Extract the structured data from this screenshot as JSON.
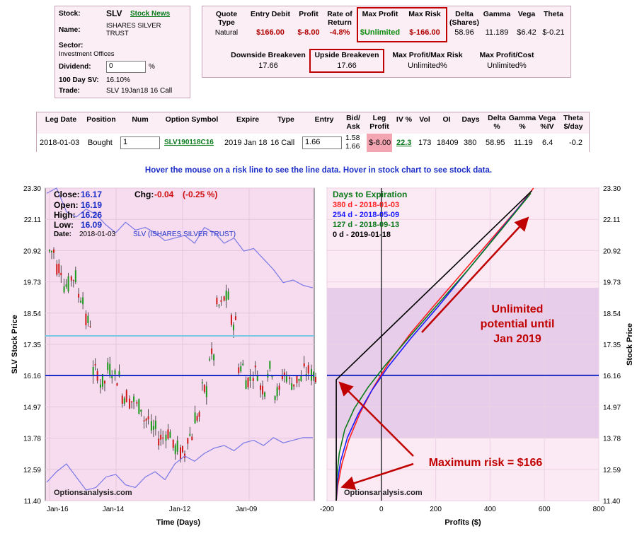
{
  "stock_info": {
    "stock_label": "Stock:",
    "ticker": "SLV",
    "news_link": "Stock News",
    "name_label": "Name:",
    "name_line1": "ISHARES SILVER",
    "name_line2": "TRUST",
    "sector_label": "Sector:",
    "sector": "Investment Offices",
    "dividend_label": "Dividend:",
    "dividend_value": "0",
    "dividend_unit": "%",
    "sv_label": "100 Day SV:",
    "sv_value": "16.10%",
    "trade_label": "Trade:",
    "trade_value": "SLV 19Jan18 16 Call"
  },
  "quote": {
    "headers": {
      "quote_type": "Quote Type",
      "entry_debit": "Entry Debit",
      "profit": "Profit",
      "ror": "Rate of Return",
      "max_profit": "Max Profit",
      "max_risk": "Max Risk",
      "delta": "Delta (Shares)",
      "gamma": "Gamma",
      "vega": "Vega",
      "theta": "Theta"
    },
    "values": {
      "quote_type": "Natural",
      "entry_debit": "$166.00",
      "profit": "$-8.00",
      "ror": "-4.8%",
      "max_profit": "$Unlimited",
      "max_risk": "$-166.00",
      "delta": "58.96",
      "gamma": "11.189",
      "vega": "$6.42",
      "theta": "$-0.21"
    },
    "row2_headers": {
      "downside": "Downside Breakeven",
      "upside": "Upside Breakeven",
      "mp_mr": "Max Profit/Max Risk",
      "mp_cost": "Max Profit/Cost"
    },
    "row2_values": {
      "downside": "17.66",
      "upside": "17.66",
      "mp_mr": "Unlimited%",
      "mp_cost": "Unlimited%"
    }
  },
  "legs": {
    "headers": {
      "leg_date": "Leg Date",
      "position": "Position",
      "num": "Num",
      "symbol": "Option Symbol",
      "expire": "Expire",
      "type": "Type",
      "entry": "Entry",
      "bid_ask": "Bid/ Ask",
      "leg_profit": "Leg Profit",
      "iv": "IV %",
      "vol": "Vol",
      "oi": "OI",
      "days": "Days",
      "delta": "Delta %",
      "gamma": "Gamma %",
      "vega": "Vega %IV",
      "theta": "Theta $/day"
    },
    "rows": [
      {
        "leg_date": "2018-01-03",
        "position": "Bought",
        "num": "1",
        "symbol": "SLV190118C16",
        "expire": "2019 Jan 18",
        "type": "16 Call",
        "entry": "1.66",
        "bid": "1.58",
        "ask": "1.66",
        "leg_profit": "$-8.00",
        "iv": "22.3",
        "vol": "173",
        "oi": "18409",
        "days": "380",
        "delta": "58.95",
        "gamma": "11.19",
        "vega": "6.4",
        "theta": "-0.2"
      }
    ]
  },
  "hover_note": "Hover the mouse on a risk line to see the line data. Hover in stock chart to see stock data.",
  "stock_chart": {
    "ylabel": "SLV Stock Price",
    "xlabel": "Time (Days)",
    "x_ticks": [
      "Jan-16",
      "Jan-14",
      "Jan-12",
      "Jan-09"
    ],
    "watermark": "Optionsanalysis.com",
    "info": {
      "close_label": "Close:",
      "close": "16.17",
      "open_label": "Open:",
      "open": "16.19",
      "high_label": "High:",
      "high": "16.26",
      "low_label": "Low:",
      "low": "16.09",
      "date_label": "Date:",
      "date": "2018-01-03",
      "chg_label": "Chg:",
      "chg": "-0.04",
      "chg_pct": "(-0.25 %)",
      "name": "SLV (ISHARES SILVER TRUST)"
    }
  },
  "chart_data": {
    "type": "line",
    "y_ticks": [
      "23.30",
      "22.11",
      "20.92",
      "19.73",
      "18.54",
      "17.35",
      "16.16",
      "14.97",
      "13.78",
      "12.59",
      "11.40"
    ],
    "ylim": [
      11.4,
      23.3
    ],
    "xlim": [
      -200,
      800
    ],
    "x_ticks": [
      -200,
      0,
      200,
      400,
      600,
      800
    ],
    "xlabel": "Profits ($)",
    "ylabel": "Stock Price",
    "legend_title": "Days to Expiration",
    "series": [
      {
        "name": "380 d - 2018-01-03",
        "color": "#ff2020",
        "x": [
          -166,
          -160,
          -145,
          -120,
          -80,
          -30,
          30,
          110,
          200,
          300,
          400,
          500,
          560
        ],
        "y": [
          11.4,
          12.0,
          12.8,
          13.7,
          14.7,
          15.7,
          16.7,
          17.8,
          18.9,
          20.1,
          21.3,
          22.5,
          23.3
        ]
      },
      {
        "name": "254 d - 2018-05-09",
        "color": "#1a1aff",
        "x": [
          -166,
          -162,
          -150,
          -125,
          -85,
          -35,
          25,
          110,
          210,
          320,
          430,
          540
        ],
        "y": [
          11.4,
          12.1,
          12.9,
          13.8,
          14.7,
          15.6,
          16.5,
          17.6,
          18.8,
          20.2,
          21.6,
          23.0
        ]
      },
      {
        "name": "127 d - 2018-09-13",
        "color": "#0a7a1a",
        "x": [
          -166,
          -164,
          -155,
          -135,
          -100,
          -50,
          10,
          100,
          210,
          320,
          440,
          550
        ],
        "y": [
          11.4,
          12.3,
          13.2,
          14.1,
          14.9,
          15.7,
          16.5,
          17.6,
          18.9,
          20.2,
          21.7,
          23.1
        ]
      },
      {
        "name": "0 d - 2019-01-18",
        "color": "#000000",
        "x": [
          -166,
          -166,
          0,
          200,
          400,
          554
        ],
        "y": [
          11.4,
          16.0,
          17.66,
          19.66,
          21.66,
          23.2
        ]
      }
    ]
  },
  "annotations": {
    "unlimited_line1": "Unlimited",
    "unlimited_line2": "potential until",
    "unlimited_line3": "Jan 2019",
    "max_risk": "Maximum risk = $166",
    "watermark": "Optionsanalysis.com"
  }
}
